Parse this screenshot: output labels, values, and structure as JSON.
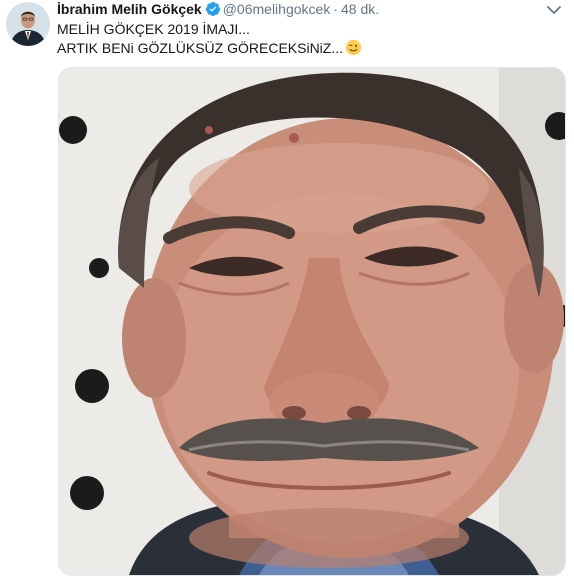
{
  "tweet": {
    "author_name": "İbrahim Melih Gökçek",
    "handle": "@06melihgokcek",
    "separator": "·",
    "time": "48 dk.",
    "text_lines": [
      "MELİH GÖKÇEK 2019 İMAJI...",
      "ARTIK BENi GÖZLÜKSÜZ GÖRECEKSiNiZ..."
    ],
    "emoji": "winking-face",
    "verified": true
  },
  "icons": {
    "verified": "verified-badge-icon",
    "menu": "chevron-down-icon"
  },
  "colors": {
    "verified_blue": "#1da1f2",
    "muted_text": "#657786",
    "emoji_yellow": "#ffcc4d"
  }
}
